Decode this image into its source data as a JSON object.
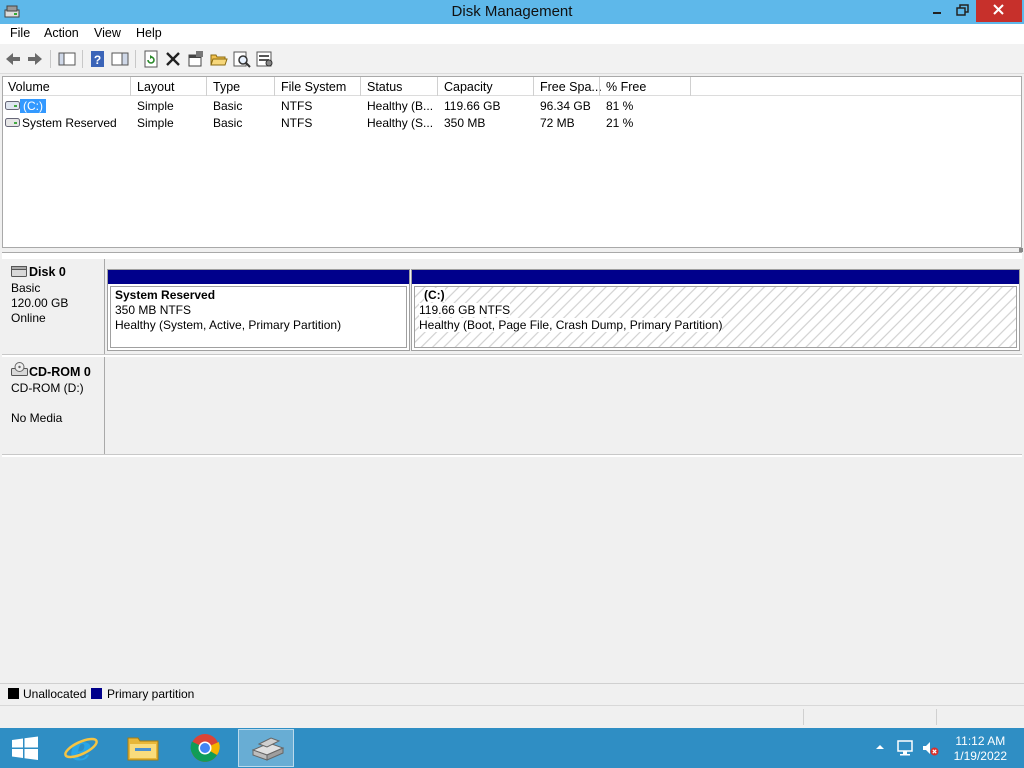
{
  "window": {
    "title": "Disk Management"
  },
  "menu": [
    "File",
    "Action",
    "View",
    "Help"
  ],
  "volume_list": {
    "columns": [
      "Volume",
      "Layout",
      "Type",
      "File System",
      "Status",
      "Capacity",
      "Free Spa...",
      "% Free"
    ],
    "rows": [
      {
        "volume": "(C:)",
        "layout": "Simple",
        "type": "Basic",
        "fs": "NTFS",
        "status": "Healthy (B...",
        "capacity": "119.66 GB",
        "free": "96.34 GB",
        "pct": "81 %",
        "selected": true
      },
      {
        "volume": "System Reserved",
        "layout": "Simple",
        "type": "Basic",
        "fs": "NTFS",
        "status": "Healthy (S...",
        "capacity": "350 MB",
        "free": "72 MB",
        "pct": "21 %",
        "selected": false
      }
    ]
  },
  "disks": [
    {
      "name": "Disk 0",
      "lines": [
        "Basic",
        "120.00 GB",
        "Online"
      ],
      "partitions": [
        {
          "title": "System Reserved",
          "size": "350 MB NTFS",
          "status": "Healthy (System, Active, Primary Partition)"
        },
        {
          "title": "(C:)",
          "size": "119.66 GB NTFS",
          "status": "Healthy (Boot, Page File, Crash Dump, Primary Partition)"
        }
      ]
    },
    {
      "name": "CD-ROM 0",
      "lines": [
        "CD-ROM (D:)",
        "No Media"
      ]
    }
  ],
  "legend": [
    {
      "label": "Unallocated",
      "color": "#000000"
    },
    {
      "label": "Primary partition",
      "color": "#00008b"
    }
  ],
  "colors": {
    "titlebar": "#5eb8ea",
    "taskbar": "#2f8ec4",
    "partition_bar": "#00008b",
    "selection": "#3399ff",
    "close": "#c7302b"
  },
  "taskbar": {
    "items": [
      "start-icon",
      "internet-explorer-icon",
      "file-explorer-icon",
      "chrome-icon",
      "disk-management-icon"
    ],
    "clock": {
      "time": "11:12 AM",
      "date": "1/19/2022"
    }
  }
}
